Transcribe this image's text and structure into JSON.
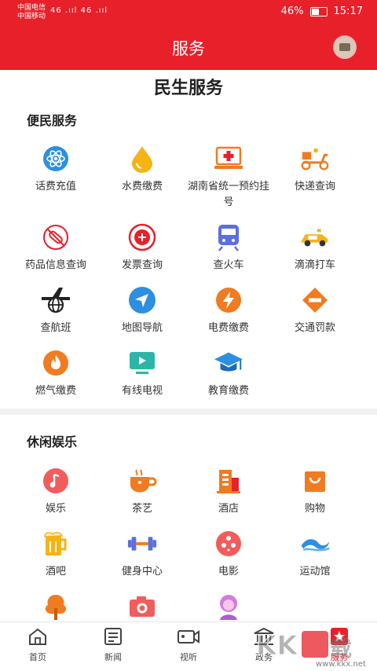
{
  "status_bar": {
    "carrier_1": "中国电信",
    "carrier_2": "中国移动",
    "net": "46 .ııl 46 .ııl",
    "battery_pct": "46%",
    "time": "15:17"
  },
  "header": {
    "title": "服务"
  },
  "page": {
    "section_title": "民生服务"
  },
  "groups": {
    "bianmin": {
      "title": "便民服务",
      "items": [
        {
          "label": "话费充值",
          "icon": "atom-icon"
        },
        {
          "label": "水费缴费",
          "icon": "water-drop-icon"
        },
        {
          "label": "湖南省统一预约挂号",
          "icon": "hospital-laptop-icon"
        },
        {
          "label": "快递查询",
          "icon": "delivery-scooter-icon"
        },
        {
          "label": "药品信息查询",
          "icon": "medicine-icon"
        },
        {
          "label": "发票查询",
          "icon": "seal-icon"
        },
        {
          "label": "查火车",
          "icon": "train-icon"
        },
        {
          "label": "滴滴打车",
          "icon": "car-icon"
        },
        {
          "label": "查航班",
          "icon": "airplane-globe-icon"
        },
        {
          "label": "地图导航",
          "icon": "navigation-arrow-icon"
        },
        {
          "label": "电费缴费",
          "icon": "lightning-icon"
        },
        {
          "label": "交通罚款",
          "icon": "no-entry-icon"
        },
        {
          "label": "燃气缴费",
          "icon": "flame-icon"
        },
        {
          "label": "有线电视",
          "icon": "tv-icon"
        },
        {
          "label": "教育缴费",
          "icon": "graduation-cap-icon"
        }
      ]
    },
    "xiuxian": {
      "title": "休闲娱乐",
      "items": [
        {
          "label": "娱乐",
          "icon": "music-note-icon"
        },
        {
          "label": "茶艺",
          "icon": "tea-cup-icon"
        },
        {
          "label": "酒店",
          "icon": "building-icon"
        },
        {
          "label": "购物",
          "icon": "shopping-bag-icon"
        },
        {
          "label": "酒吧",
          "icon": "beer-mug-icon"
        },
        {
          "label": "健身中心",
          "icon": "dumbbell-icon"
        },
        {
          "label": "电影",
          "icon": "film-reel-icon"
        },
        {
          "label": "运动馆",
          "icon": "wave-icon"
        },
        {
          "label": "",
          "icon": "tree-icon"
        },
        {
          "label": "",
          "icon": "camera-icon"
        },
        {
          "label": "",
          "icon": "woman-icon"
        }
      ]
    }
  },
  "tabs": [
    {
      "label": "首页",
      "icon": "home-icon"
    },
    {
      "label": "新闻",
      "icon": "news-icon"
    },
    {
      "label": "视听",
      "icon": "video-camera-icon"
    },
    {
      "label": "政务",
      "icon": "government-icon"
    },
    {
      "label": "服务",
      "icon": "star-service-icon"
    }
  ],
  "watermark": {
    "brand": "KK下载",
    "url": "www.kkx.net"
  },
  "colors": {
    "brand": "#e8202a",
    "orange": "#f07b21",
    "blue": "#2d8fe0",
    "yellow": "#f5b316"
  }
}
